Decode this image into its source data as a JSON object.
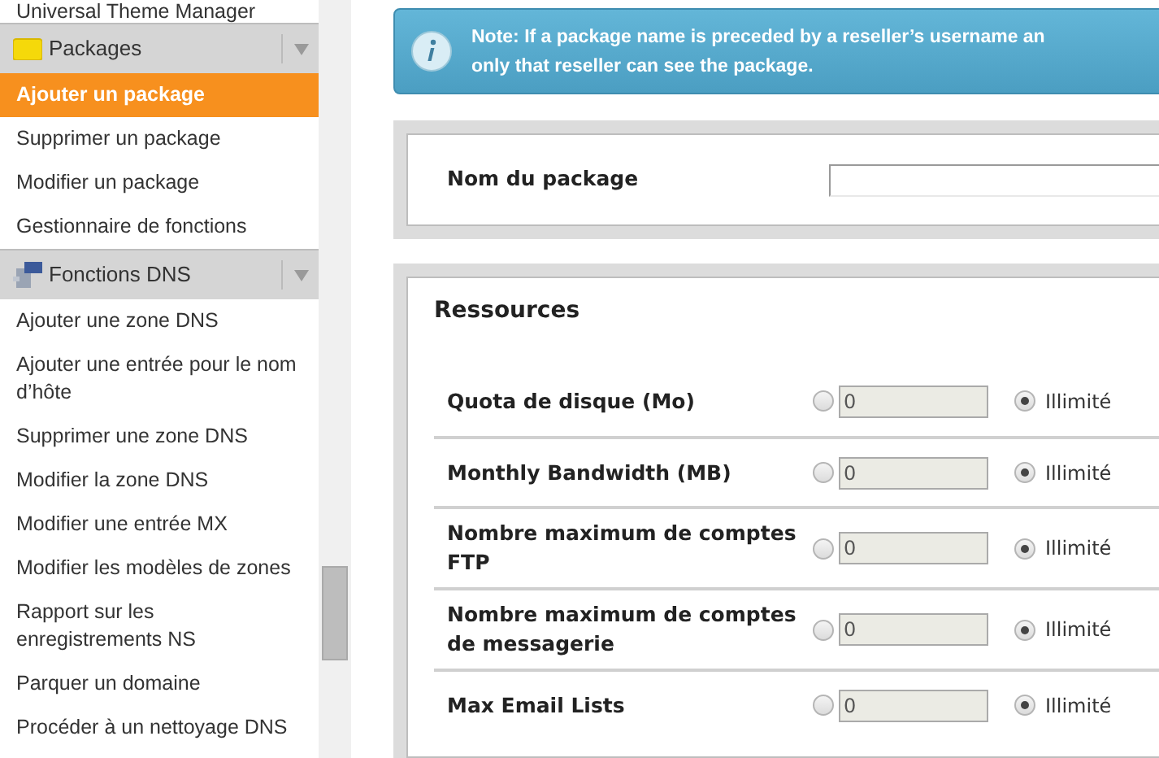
{
  "sidebar": {
    "items": [
      {
        "kind": "item",
        "label": "Universal Theme Manager",
        "selected": false
      },
      {
        "kind": "header",
        "label": "Packages"
      },
      {
        "kind": "item",
        "label": "Ajouter un package",
        "selected": true
      },
      {
        "kind": "item",
        "label": "Supprimer un package",
        "selected": false
      },
      {
        "kind": "item",
        "label": "Modifier un package",
        "selected": false
      },
      {
        "kind": "item",
        "label": "Gestionnaire de fonctions",
        "selected": false
      },
      {
        "kind": "header",
        "label": "Fonctions DNS"
      },
      {
        "kind": "item",
        "label": "Ajouter une zone DNS",
        "selected": false
      },
      {
        "kind": "item",
        "label": "Ajouter une entrée pour le nom d’hôte",
        "selected": false
      },
      {
        "kind": "item",
        "label": "Supprimer une zone DNS",
        "selected": false
      },
      {
        "kind": "item",
        "label": "Modifier la zone DNS",
        "selected": false
      },
      {
        "kind": "item",
        "label": "Modifier une entrée MX",
        "selected": false
      },
      {
        "kind": "item",
        "label": "Modifier les modèles de zones",
        "selected": false
      },
      {
        "kind": "item",
        "label": "Rapport sur les enregistrements NS",
        "selected": false
      },
      {
        "kind": "item",
        "label": "Parquer un domaine",
        "selected": false
      },
      {
        "kind": "item",
        "label": "Procéder à un nettoyage DNS",
        "selected": false
      }
    ]
  },
  "note": {
    "line1": "Note: If a package name is preceded by a reseller’s username an",
    "line2": "only that reseller can see the package."
  },
  "package_name": {
    "label": "Nom du package"
  },
  "resources": {
    "title": "Ressources",
    "rows": [
      {
        "label": "Quota de disque (Mo)",
        "value": "0",
        "unlimited_label": "Illimité",
        "unlimited": true
      },
      {
        "label": "Monthly Bandwidth (MB)",
        "value": "0",
        "unlimited_label": "Illimité",
        "unlimited": true
      },
      {
        "label": "Nombre maximum de comptes FTP",
        "value": "0",
        "unlimited_label": "Illimité",
        "unlimited": true
      },
      {
        "label": "Nombre maximum de comptes de messagerie",
        "value": "0",
        "unlimited_label": "Illimité",
        "unlimited": true
      },
      {
        "label": "Max Email Lists",
        "value": "0",
        "unlimited_label": "Illimité",
        "unlimited": true
      }
    ]
  }
}
